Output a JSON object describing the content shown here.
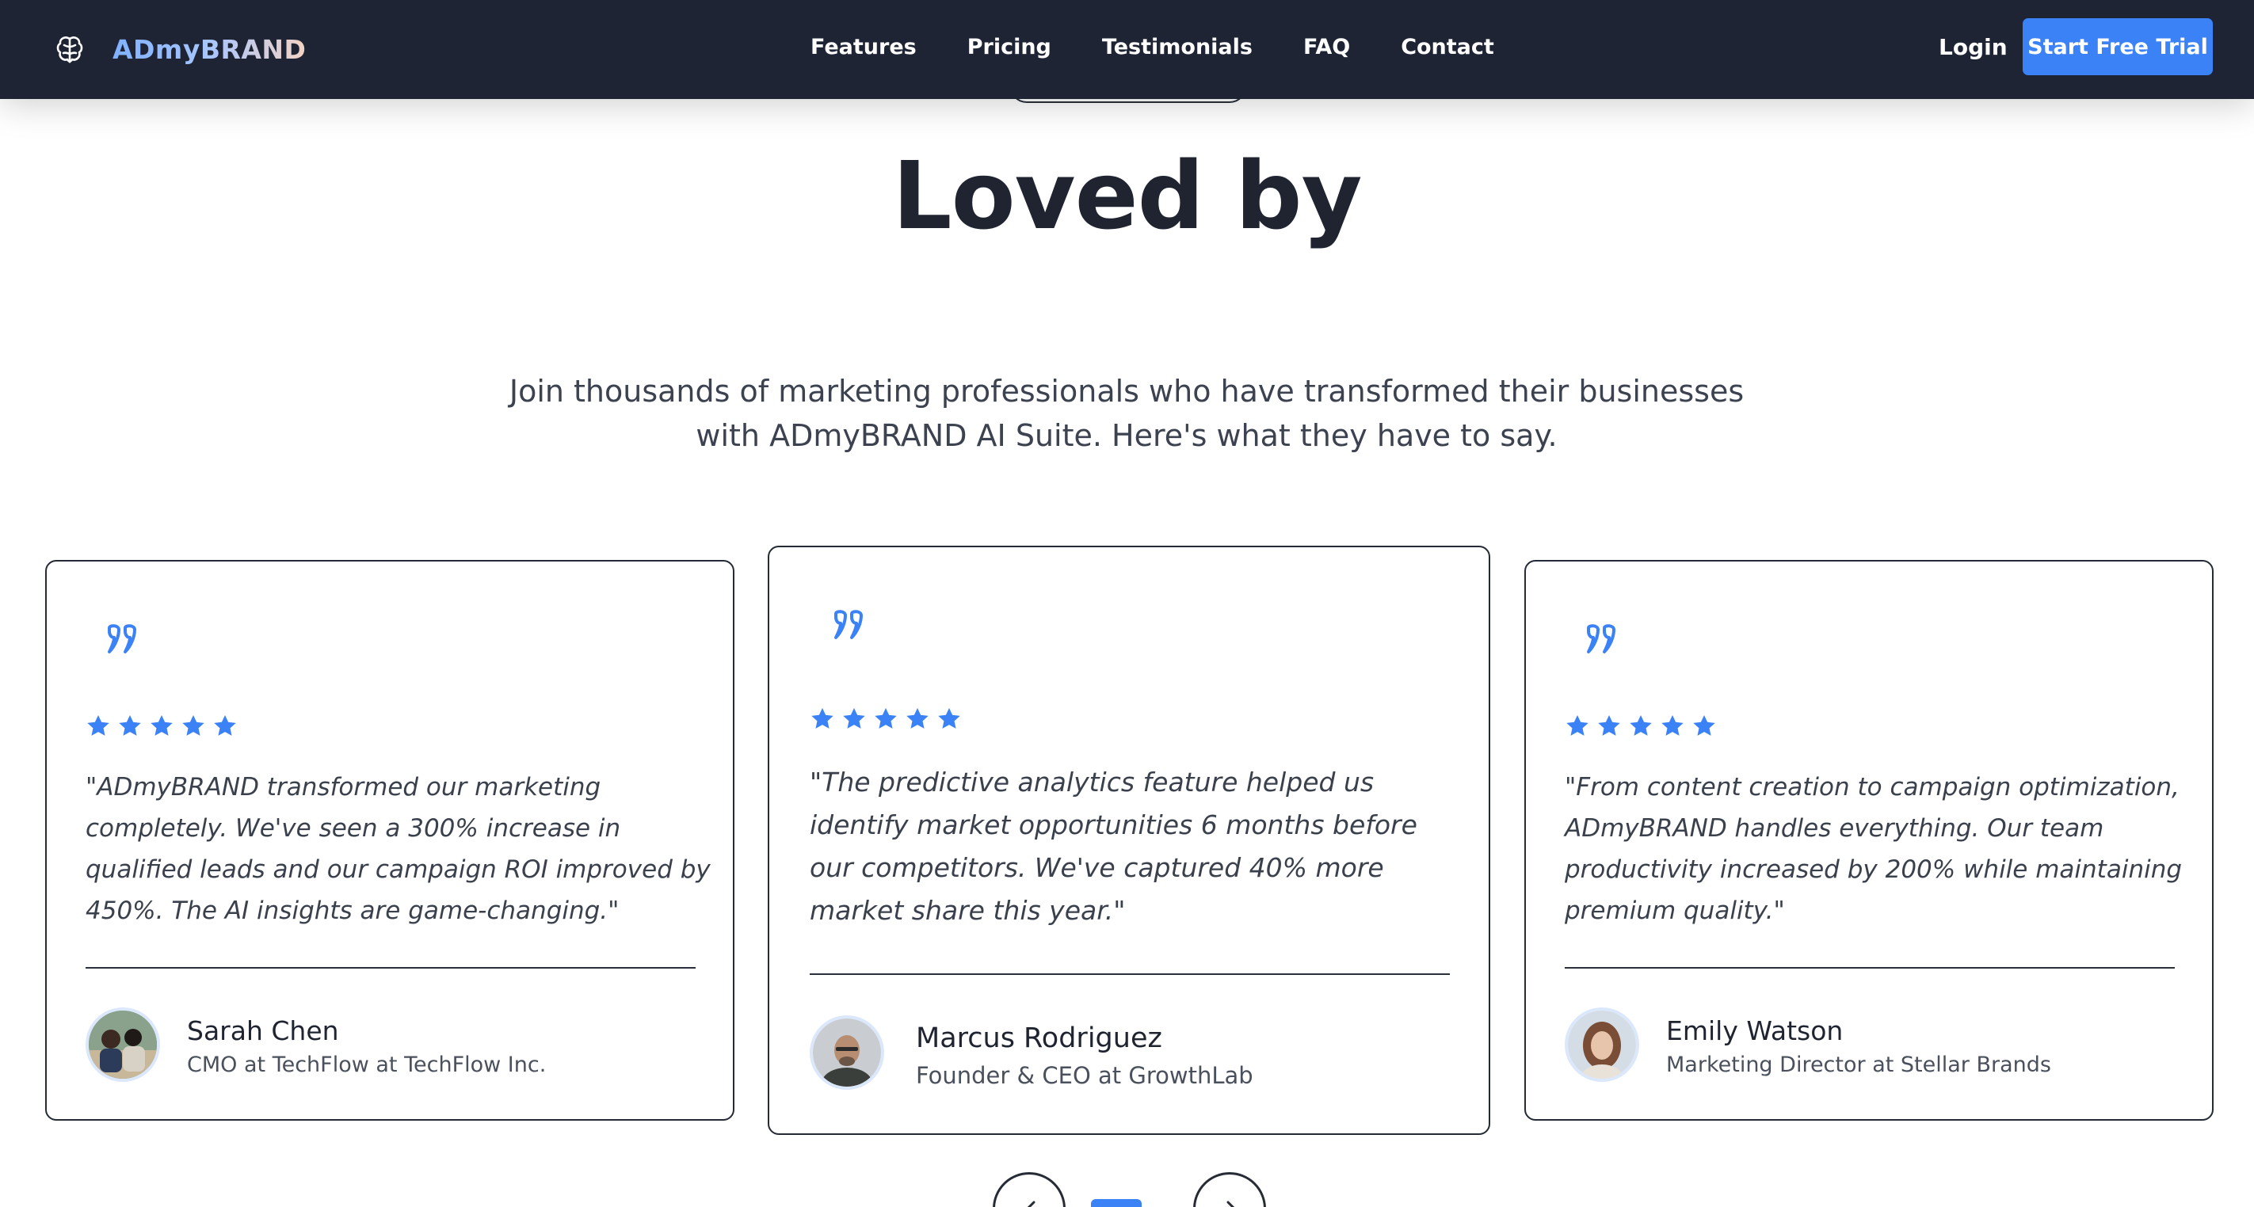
{
  "nav": {
    "brand": "ADmyBRAND",
    "brand_icon": "brain-icon",
    "links": [
      "Features",
      "Pricing",
      "Testimonials",
      "FAQ",
      "Contact"
    ],
    "login": "Login",
    "cta": "Start Free Trial"
  },
  "section": {
    "heading": "Loved by",
    "subtitle": "Join thousands of marketing professionals who have transformed their businesses with ADmyBRAND AI Suite. Here's what they have to say."
  },
  "testimonials": [
    {
      "rating": 5,
      "quote": "\"ADmyBRAND transformed our marketing completely. We've seen a 300% increase in qualified leads and our campaign ROI improved by 450%. The AI insights are game-changing.\"",
      "name": "Sarah Chen",
      "role": "CMO at TechFlow at TechFlow Inc."
    },
    {
      "rating": 5,
      "quote": "\"The predictive analytics feature helped us identify market opportunities 6 months before our competitors. We've captured 40% more market share this year.\"",
      "name": "Marcus Rodriguez",
      "role": "Founder & CEO at GrowthLab"
    },
    {
      "rating": 5,
      "quote": "\"From content creation to campaign optimization, ADmyBRAND handles everything. Our team productivity increased by 200% while maintaining premium quality.\"",
      "name": "Emily Watson",
      "role": "Marketing Director at Stellar Brands"
    }
  ],
  "carousel": {
    "prev_icon": "chevron-left-icon",
    "next_icon": "chevron-right-icon",
    "active_slide": 1
  },
  "colors": {
    "nav_bg": "#1e2433",
    "accent": "#3b82f6",
    "text": "#1f2430",
    "muted": "#4a505c",
    "border": "#242a36"
  }
}
